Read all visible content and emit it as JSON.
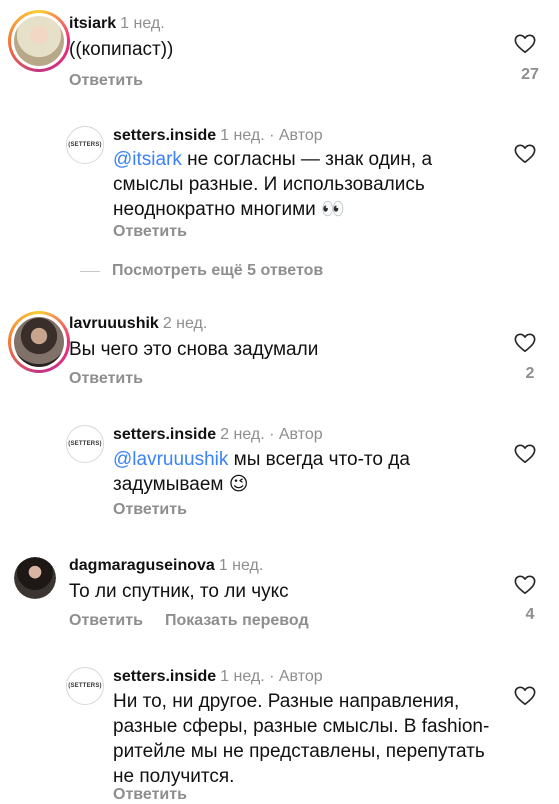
{
  "c1": {
    "user": "itsiark",
    "time": "1 нед.",
    "text": "((копипаст))",
    "reply": "Ответить",
    "likes": "27"
  },
  "r1": {
    "user": "setters.inside",
    "time": "1 нед. · Автор",
    "brand": "(SETTERS)",
    "mention": "@itsiark",
    "text": " не согласны — знак один, а смыслы разные. И использовались неоднократно многими 👀",
    "reply": "Ответить"
  },
  "more": {
    "label": "Посмотреть ещё 5 ответов"
  },
  "c2": {
    "user": "lavruuushik",
    "time": "2 нед.",
    "text": "Вы чего это снова задумали",
    "reply": "Ответить",
    "likes": "2"
  },
  "r2": {
    "user": "setters.inside",
    "time": "2 нед. · Автор",
    "brand": "(SETTERS)",
    "mention": "@lavruuushik",
    "text": " мы всегда что-то да задумываем 😉",
    "reply": "Ответить"
  },
  "c3": {
    "user": "dagmaraguseinova",
    "time": "1 нед.",
    "text": "То ли спутник, то ли чукс",
    "reply": "Ответить",
    "translate": "Показать перевод",
    "likes": "4"
  },
  "r3": {
    "user": "setters.inside",
    "time": "1 нед. · Автор",
    "brand": "(SETTERS)",
    "text": "Ни то, ни другое. Разные направления, разные сферы, разные смыслы. В fashion-ритейле мы не представлены, перепутать не получится.",
    "reply": "Ответить"
  }
}
